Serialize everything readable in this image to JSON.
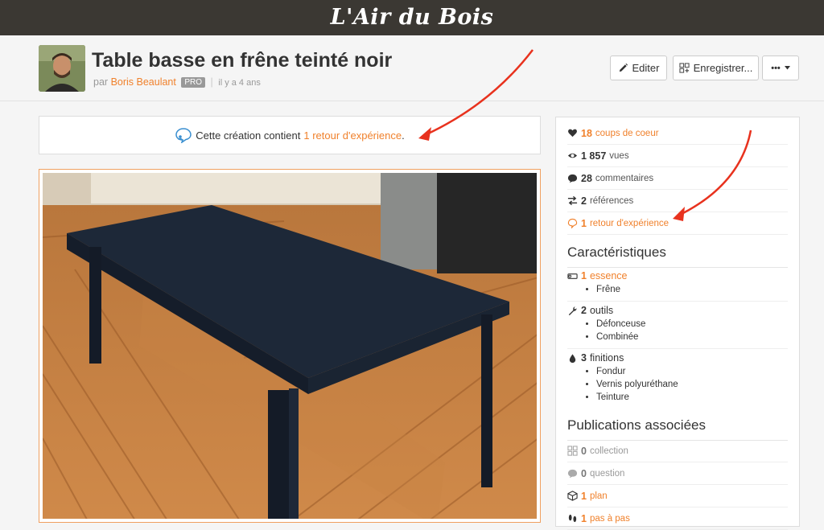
{
  "site": {
    "logo": "L'Air du Bois"
  },
  "header": {
    "title": "Table basse en frêne teinté noir",
    "by_prefix": "par",
    "author": "Boris Beaulant",
    "badge": "PRO",
    "time_ago": "il y a 4 ans",
    "edit_label": "Editer",
    "save_label": "Enregistrer...",
    "more_label": "•••"
  },
  "notice": {
    "text_before": "Cette création contient",
    "link": "1 retour d'expérience",
    "text_after": "."
  },
  "stats": [
    {
      "icon": "heart-icon",
      "count": "18",
      "label": "coups de coeur",
      "style": "link"
    },
    {
      "icon": "eye-icon",
      "count": "1 857",
      "label": "vues",
      "style": "normal"
    },
    {
      "icon": "comment-icon",
      "count": "28",
      "label": "commentaires",
      "style": "normal"
    },
    {
      "icon": "exchange-icon",
      "count": "2",
      "label": "références",
      "style": "normal"
    },
    {
      "icon": "feedback-icon",
      "count": "1",
      "label": "retour d'expérience",
      "style": "link"
    }
  ],
  "characteristics": {
    "title": "Caractéristiques",
    "groups": [
      {
        "icon": "wood-icon",
        "count": "1",
        "label": "essence",
        "items": [
          "Frêne"
        ],
        "style": "link"
      },
      {
        "icon": "wrench-icon",
        "count": "2",
        "label": "outils",
        "items": [
          "Défonceuse",
          "Combinée"
        ],
        "style": "normal"
      },
      {
        "icon": "drop-icon",
        "count": "3",
        "label": "finitions",
        "items": [
          "Fondur",
          "Vernis polyuréthane",
          "Teinture"
        ],
        "style": "normal"
      }
    ]
  },
  "publications": {
    "title": "Publications associées",
    "rows": [
      {
        "icon": "collection-icon",
        "count": "0",
        "label": "collection",
        "style": "gray"
      },
      {
        "icon": "question-icon",
        "count": "0",
        "label": "question",
        "style": "gray"
      },
      {
        "icon": "cube-icon",
        "count": "1",
        "label": "plan",
        "style": "link"
      },
      {
        "icon": "footsteps-icon",
        "count": "1",
        "label": "pas à pas",
        "style": "link"
      }
    ]
  },
  "colors": {
    "accent": "#f0812c",
    "topbar": "#3b3833",
    "arrow": "#e8321e"
  }
}
